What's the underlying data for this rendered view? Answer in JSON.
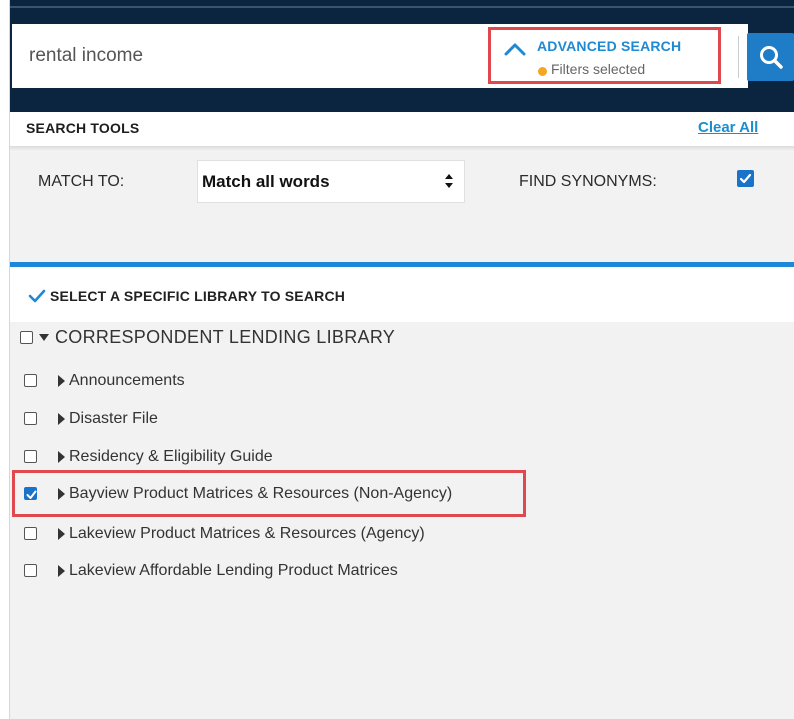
{
  "search": {
    "value": "rental income",
    "advanced_label": "ADVANCED SEARCH",
    "filters_label": "Filters selected",
    "button_icon": "search-icon",
    "chevron_icon": "chevron-up-icon"
  },
  "search_tools": {
    "title": "SEARCH TOOLS",
    "clear_all": "Clear All",
    "match_to_label": "MATCH TO:",
    "match_to_value": "Match all words",
    "find_synonyms_label": "FIND SYNONYMS:",
    "find_synonyms_checked": true
  },
  "library": {
    "header": "SELECT A SPECIFIC LIBRARY TO SEARCH",
    "root": {
      "label": "CORRESPONDENT LENDING LIBRARY",
      "checked": false,
      "expanded": true
    },
    "items": [
      {
        "label": "Announcements",
        "checked": false
      },
      {
        "label": "Disaster File",
        "checked": false
      },
      {
        "label": "Residency & Eligibility Guide",
        "checked": false
      },
      {
        "label": "Bayview Product Matrices & Resources (Non-Agency)",
        "checked": true
      },
      {
        "label": "Lakeview Product Matrices & Resources (Agency)",
        "checked": false
      },
      {
        "label": "Lakeview Affordable Lending Product Matrices",
        "checked": false
      }
    ]
  },
  "colors": {
    "header_bg": "#0b2540",
    "accent_blue": "#1e88d8",
    "highlight_red": "#e0484f",
    "filter_dot": "#f5a623"
  }
}
